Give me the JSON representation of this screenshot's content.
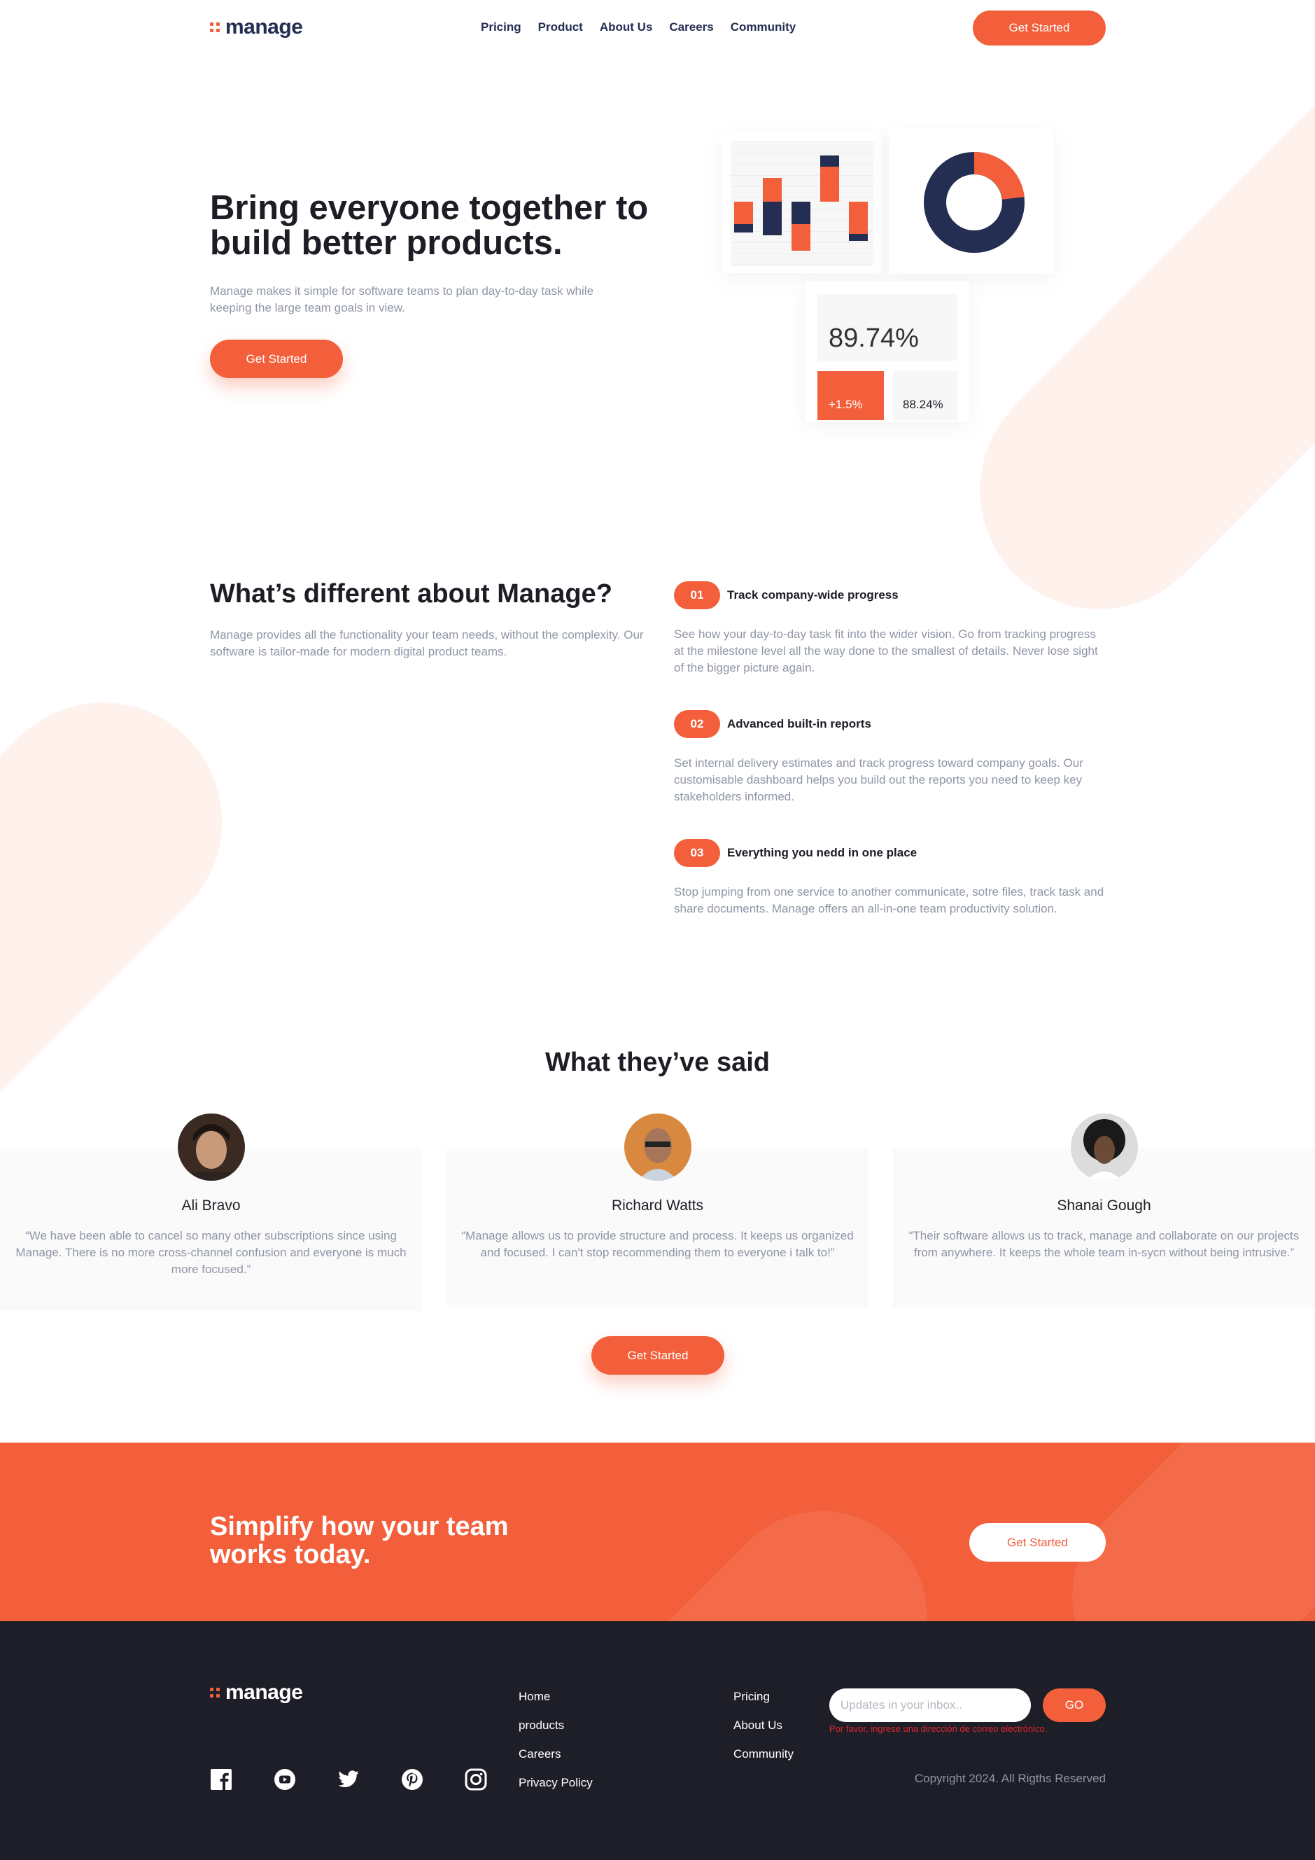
{
  "brand": {
    "name": "manage",
    "accent": "#F25F3A",
    "dark": "#242D52",
    "footer_bg": "#1D1E28"
  },
  "nav": {
    "items": [
      "Pricing",
      "Product",
      "About Us",
      "Careers",
      "Community"
    ],
    "cta": "Get Started"
  },
  "hero": {
    "title": "Bring everyone together to build better products.",
    "text": "Manage makes it simple for software teams to plan day-to-day task while keeping the large team goals in view.",
    "cta": "Get Started",
    "stats": {
      "main": "89.74%",
      "up": "+1.5%",
      "side": "88.24%"
    }
  },
  "features": {
    "title": "What’s different about Manage?",
    "text": "Manage provides all the functionality your team needs, without the complexity. Our software is tailor-made for modern digital product teams.",
    "items": [
      {
        "num": "01",
        "name": "Track company-wide progress",
        "desc": "See how your day-to-day task fit into the wider vision. Go from tracking progress at the milestone level all the way done to the smallest of details. Never lose sight of the bigger picture again."
      },
      {
        "num": "02",
        "name": "Advanced built-in reports",
        "desc": "Set internal delivery estimates and track progress toward company goals. Our customisable dashboard helps you build out the reports you need to keep key stakeholders informed."
      },
      {
        "num": "03",
        "name": "Everything you nedd in one place",
        "desc": "Stop jumping from one service to another communicate, sotre files, track task and share documents. Manage offers an all-in-one team productivity solution."
      }
    ]
  },
  "testimonials": {
    "title": "What they’ve said",
    "items": [
      {
        "name": "Ali Bravo",
        "quote": "“We have been able to cancel so many other subscriptions since using Manage. There is no more cross-channel confusion and everyone is much more focused.”"
      },
      {
        "name": "Richard Watts",
        "quote": "“Manage allows us to provide structure and process. It keeps us organized and focused. I can't stop recommending them to everyone i talk to!”"
      },
      {
        "name": "Shanai Gough",
        "quote": "“Their software allows us to track, manage and collaborate on our projects from anywhere. It keeps the whole team in-sycn without being intrusive.”"
      }
    ],
    "cta": "Get Started"
  },
  "cta": {
    "title": "Simplify how your team works today.",
    "button": "Get Started"
  },
  "footer": {
    "links1": [
      "Home",
      "products",
      "Careers",
      "Privacy Policy"
    ],
    "links2": [
      "Pricing",
      "About Us",
      "Community"
    ],
    "newsletter_placeholder": "Updates in your inbox..",
    "go": "GO",
    "error": "Por favor, ingrese una dirección de correo electrónico.",
    "copyright": "Copyright 2024. All Rigths Reserved",
    "social": [
      "facebook-icon",
      "youtube-icon",
      "twitter-icon",
      "pinterest-icon",
      "instagram-icon"
    ]
  }
}
